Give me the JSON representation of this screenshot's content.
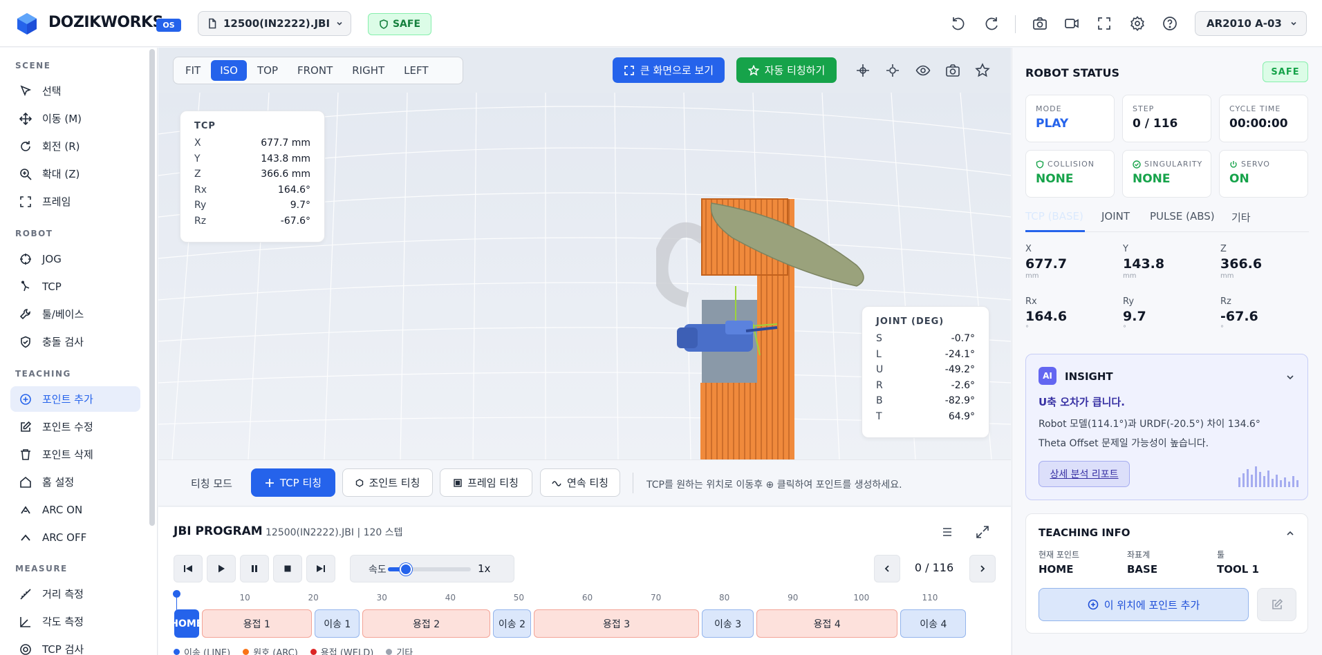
{
  "header": {
    "brand": "DOZIKWORKS",
    "os_badge": "OS",
    "file_name": "12500(IN2222).JBI",
    "safe_label": "SAFE",
    "robot_model": "AR2010 A-03",
    "icons": [
      "undo-icon",
      "redo-icon",
      "camera-icon",
      "video-icon",
      "fullscreen-icon",
      "gear-icon",
      "help-icon"
    ]
  },
  "sidebar": {
    "sections": [
      {
        "title": "SCENE",
        "items": [
          {
            "label": "선택",
            "icon": "cursor-icon"
          },
          {
            "label": "이동 (M)",
            "icon": "move-icon"
          },
          {
            "label": "회전 (R)",
            "icon": "rotate-icon"
          },
          {
            "label": "확대 (Z)",
            "icon": "zoom-icon"
          },
          {
            "label": "프레임",
            "icon": "frame-icon"
          }
        ]
      },
      {
        "title": "ROBOT",
        "items": [
          {
            "label": "JOG",
            "icon": "crosshair-icon"
          },
          {
            "label": "TCP",
            "icon": "tcp-icon"
          },
          {
            "label": "툴/베이스",
            "icon": "wrench-icon"
          },
          {
            "label": "충돌 검사",
            "icon": "shield-icon"
          }
        ]
      },
      {
        "title": "TEACHING",
        "items": [
          {
            "label": "포인트 추가",
            "icon": "plus-circle-icon",
            "active": true
          },
          {
            "label": "포인트 수정",
            "icon": "edit-icon"
          },
          {
            "label": "포인트 삭제",
            "icon": "trash-icon"
          },
          {
            "label": "홈 설정",
            "icon": "home-icon"
          },
          {
            "label": "ARC ON",
            "icon": "arc-on-icon"
          },
          {
            "label": "ARC OFF",
            "icon": "arc-off-icon"
          }
        ]
      },
      {
        "title": "MEASURE",
        "items": [
          {
            "label": "거리 측정",
            "icon": "ruler-icon"
          },
          {
            "label": "각도 측정",
            "icon": "angle-icon"
          },
          {
            "label": "TCP 검사",
            "icon": "target-icon"
          }
        ]
      }
    ]
  },
  "viewport": {
    "view_modes": [
      "FIT",
      "ISO",
      "TOP",
      "FRONT",
      "RIGHT",
      "LEFT"
    ],
    "active_view": "ISO",
    "big_view_label": "큰 화면으로 보기",
    "auto_teach_label": "자동 티칭하기",
    "tcp": {
      "title": "TCP",
      "rows": [
        {
          "k": "X",
          "v": "677.7 mm"
        },
        {
          "k": "Y",
          "v": "143.8 mm"
        },
        {
          "k": "Z",
          "v": "366.6 mm"
        },
        {
          "k": "Rx",
          "v": "164.6°"
        },
        {
          "k": "Ry",
          "v": "9.7°"
        },
        {
          "k": "Rz",
          "v": "-67.6°"
        }
      ]
    },
    "joint": {
      "title": "JOINT (DEG)",
      "rows": [
        {
          "k": "S",
          "v": "-0.7°"
        },
        {
          "k": "L",
          "v": "-24.1°"
        },
        {
          "k": "U",
          "v": "-49.2°"
        },
        {
          "k": "R",
          "v": "-2.6°"
        },
        {
          "k": "B",
          "v": "-82.9°"
        },
        {
          "k": "T",
          "v": "64.9°"
        }
      ]
    }
  },
  "teach_bar": {
    "mode_label": "티칭 모드",
    "tcp_btn": "TCP 티칭",
    "joint_btn": "조인트 티칭",
    "frame_btn": "프레임 티칭",
    "cont_btn": "연속 티칭",
    "hint": "TCP를 원하는 위치로 이동후 ⊕ 클릭하여 포인트를 생성하세요."
  },
  "program": {
    "title": "JBI PROGRAM",
    "subtitle": "12500(IN2222).JBI | 120 스텝",
    "speed_label": "속도",
    "speed_value": "1x",
    "speed_fraction": 0.22,
    "step_counter": "0 / 116",
    "ticks": [
      "10",
      "20",
      "30",
      "40",
      "50",
      "60",
      "70",
      "80",
      "90",
      "100",
      "110"
    ],
    "tick_steps": [
      10,
      20,
      30,
      40,
      50,
      60,
      70,
      80,
      90,
      100,
      110
    ],
    "total_steps": 120,
    "segments": [
      {
        "label": "HOME",
        "type": "home",
        "start": 0,
        "end": 4
      },
      {
        "label": "용접 1",
        "type": "weld",
        "start": 4,
        "end": 20.5
      },
      {
        "label": "이송 1",
        "type": "move",
        "start": 20.5,
        "end": 27.5
      },
      {
        "label": "용접 2",
        "type": "weld",
        "start": 27.5,
        "end": 46.5
      },
      {
        "label": "이송 2",
        "type": "move",
        "start": 46.5,
        "end": 52.5
      },
      {
        "label": "용접 3",
        "type": "weld",
        "start": 52.5,
        "end": 77
      },
      {
        "label": "이송 3",
        "type": "move",
        "start": 77,
        "end": 85
      },
      {
        "label": "용접 4",
        "type": "weld",
        "start": 85,
        "end": 106
      },
      {
        "label": "이송 4",
        "type": "move",
        "start": 106,
        "end": 116
      }
    ],
    "legend": [
      {
        "label": "이송 (LINE)",
        "color": "#2563eb"
      },
      {
        "label": "원호 (ARC)",
        "color": "#f97316"
      },
      {
        "label": "용접 (WELD)",
        "color": "#dc2626"
      },
      {
        "label": "기타",
        "color": "#9ca3af"
      }
    ]
  },
  "robot_status": {
    "title": "ROBOT STATUS",
    "safe": "SAFE",
    "stats": [
      {
        "label": "MODE",
        "value": "PLAY",
        "style": "blue"
      },
      {
        "label": "STEP",
        "value": "0 / 116",
        "style": ""
      },
      {
        "label": "CYCLE TIME",
        "value": "00:00:00",
        "style": ""
      },
      {
        "label": "COLLISION",
        "value": "NONE",
        "style": "green",
        "icon": "shield-check-icon"
      },
      {
        "label": "SINGULARITY",
        "value": "NONE",
        "style": "green",
        "icon": "check-circle-icon"
      },
      {
        "label": "SERVO",
        "value": "ON",
        "style": "green",
        "icon": "power-icon"
      }
    ],
    "tabs": [
      "TCP (BASE)",
      "JOINT",
      "PULSE (ABS)",
      "기타"
    ],
    "coords": [
      {
        "label": "X",
        "value": "677.7",
        "unit": "mm"
      },
      {
        "label": "Y",
        "value": "143.8",
        "unit": "mm"
      },
      {
        "label": "Z",
        "value": "366.6",
        "unit": "mm"
      },
      {
        "label": "Rx",
        "value": "164.6",
        "unit": "°"
      },
      {
        "label": "Ry",
        "value": "9.7",
        "unit": "°"
      },
      {
        "label": "Rz",
        "value": "-67.6",
        "unit": "°"
      }
    ]
  },
  "insight": {
    "badge": "AI",
    "title": "INSIGHT",
    "headline": "U축 오차가 큽니다.",
    "line1": "Robot 모델(114.1°)과 URDF(-20.5°) 차이 134.6°",
    "line2": "Theta Offset 문제일 가능성이 높습니다.",
    "report_btn": "상세 분석 리포트"
  },
  "teaching_info": {
    "title": "TEACHING INFO",
    "fields": [
      {
        "label": "현재 포인트",
        "value": "HOME"
      },
      {
        "label": "좌표계",
        "value": "BASE"
      },
      {
        "label": "툴",
        "value": "TOOL 1"
      }
    ],
    "add_btn": "이 위치에 포인트 추가"
  }
}
